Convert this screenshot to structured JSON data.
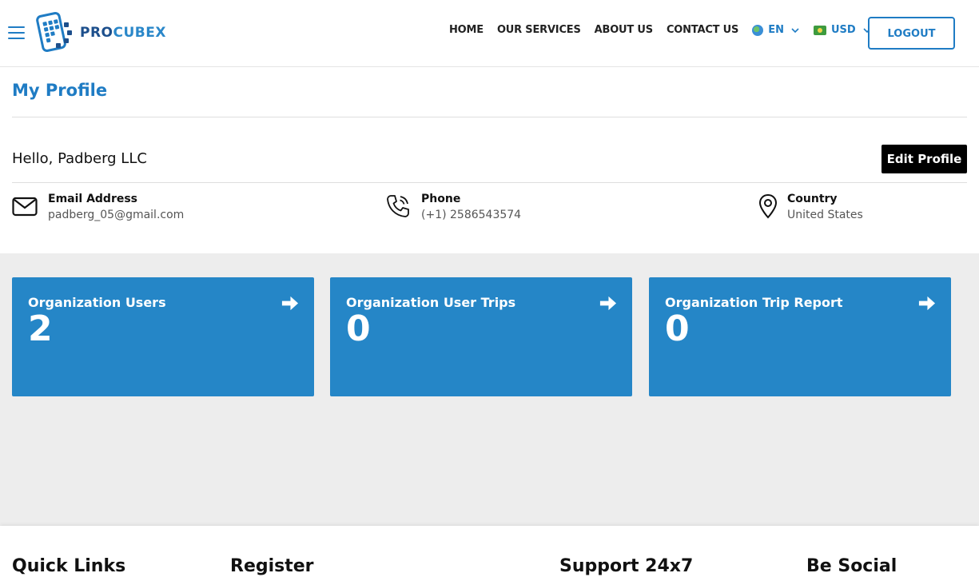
{
  "header": {
    "brand_part1": "PRO",
    "brand_part2": "CUBEX",
    "nav": [
      "HOME",
      "OUR SERVICES",
      "ABOUT US",
      "CONTACT US"
    ],
    "language": "EN",
    "currency": "USD",
    "logout_label": "LOGOUT"
  },
  "profile": {
    "title": "My Profile",
    "greeting": "Hello, Padberg LLC",
    "edit_label": "Edit Profile",
    "email_label": "Email Address",
    "email": "padberg_05@gmail.com",
    "phone_label": "Phone",
    "phone": "(+1) 2586543574",
    "country_label": "Country",
    "country": "United States"
  },
  "cards": [
    {
      "title": "Organization Users",
      "value": "2"
    },
    {
      "title": "Organization User Trips",
      "value": "0"
    },
    {
      "title": "Organization Trip Report",
      "value": "0"
    }
  ],
  "footer": {
    "quick_links": "Quick Links",
    "register": "Register",
    "support": "Support 24x7",
    "social": "Be Social"
  },
  "colors": {
    "accent": "#1f7cc4",
    "card": "#2586c7",
    "stats_bg": "#ededed"
  }
}
